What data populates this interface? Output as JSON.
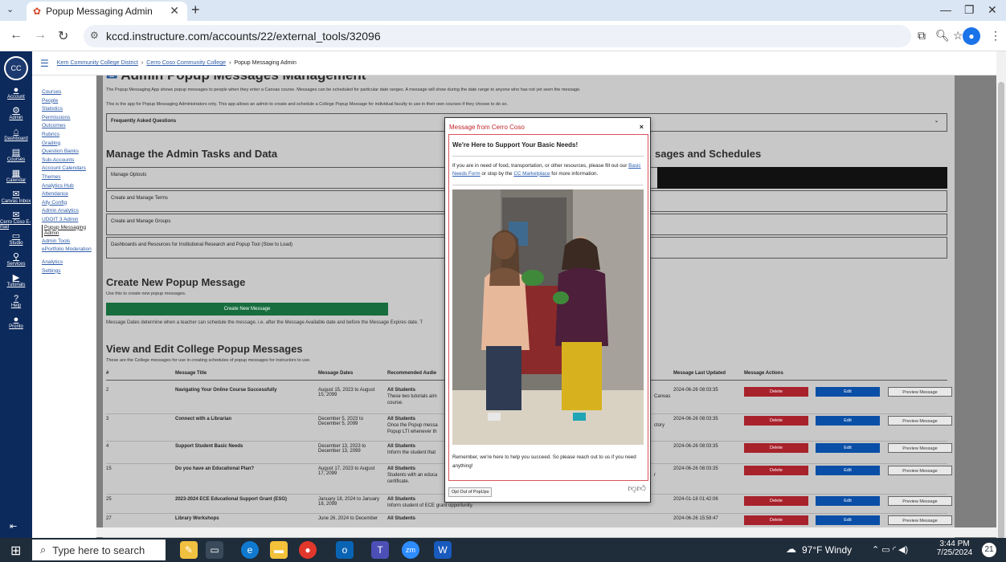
{
  "browser": {
    "tab_title": "Popup Messaging Admin",
    "url": "kccd.instructure.com/accounts/22/external_tools/32096"
  },
  "global_nav": [
    "Account",
    "Admin",
    "Dashboard",
    "Courses",
    "Calendar",
    "Canvas Inbox",
    "Cerro Coso E-mail",
    "Studio",
    "Services",
    "Tutorials",
    "Help",
    "Pronto"
  ],
  "breadcrumb": [
    "Kern Community College District",
    "Cerro Coso Community College",
    "Popup Messaging Admin"
  ],
  "sub_nav": [
    "Courses",
    "People",
    "Statistics",
    "Permissions",
    "Outcomes",
    "Rubrics",
    "Grading",
    "Question Banks",
    "Sub-Accounts",
    "Account Calendars",
    "Themes",
    "Analytics Hub",
    "Attendance",
    "Ally Config",
    "Admin Analytics",
    "UDOIT 3 Admin",
    "Popup Messaging Admin",
    "Admin Tools",
    "ePortfolio Moderation",
    "Analytics",
    "Settings"
  ],
  "page": {
    "title": "Admin Popup Messages Management",
    "intro1": "The Popup Messaging App shows popup messages to people when they enter a Canvas course. Messages can be scheduled for particular date ranges. A message will show during the date range to anyone who has not yet seen the message.",
    "intro2": "This is the app for Popup Messaging Administrators only. This app allows an admin to create and schedule a College Popup Message for individual faculty to use in their own courses if they choose to do so.",
    "faq": "Frequently Asked Questions",
    "manage_heading": "Manage the Admin Tasks and Data",
    "manage_right_heading": "sages and Schedules",
    "optouts": "Manage Optouts",
    "terms": "Create and Manage Terms",
    "groups": "Create and Manage Groups",
    "dashboards": "Dashboards and Resources for Institutional Research and Popup Tool (Slow to Load)",
    "create_heading": "Create New Popup Message",
    "create_sub": "Use this to create new popup messages.",
    "create_btn": "Create New Message",
    "dates_note": "Message Dates determine when a teacher can schedule the message. i.e. after the Message Available date and before the Message Expires date. T",
    "view_heading": "View and Edit College Popup Messages",
    "view_sub": "These are the College messages for use in creating schedules of popup messages for instructors to use."
  },
  "table": {
    "headers": [
      "#",
      "Message Title",
      "Message Dates",
      "Recommended Audie",
      "Message Last Updated",
      "Message Actions"
    ],
    "rows": [
      {
        "id": "2",
        "title": "Navigating Your Online Course Successfully",
        "dates": "August 15, 2023 to August 15, 2099",
        "aud": "All Students",
        "desc": "These two tutorials aim",
        "desc2": "course.",
        "tail": "Canvas",
        "updated": "2024-06-26 08:03:35"
      },
      {
        "id": "3",
        "title": "Connect with a Librarian",
        "dates": "December 5, 2023 to December 5, 2099",
        "aud": "All Students",
        "desc": "Once the Popup messa",
        "desc2": "Popup LTI whenever th",
        "tail": "ctory",
        "updated": "2024-06-26 08:03:35"
      },
      {
        "id": "4",
        "title": "Support Student Basic Needs",
        "dates": "December 13, 2023 to December 13, 2099",
        "aud": "All Students",
        "desc": "Inform the student that",
        "desc2": "",
        "tail": "",
        "updated": "2024-06-26 08:03:35"
      },
      {
        "id": "15",
        "title": "Do you have an Educational Plan?",
        "dates": "August 17, 2023 to August 17, 2099",
        "aud": "All Students",
        "desc": "Students with an educa",
        "desc2": "certificate.",
        "tail": "r",
        "updated": "2024-06-26 08:03:35"
      },
      {
        "id": "25",
        "title": "2023-2024 ECE Educational Support Grant (ESG)",
        "dates": "January 18, 2024 to January 18, 2099",
        "aud": "All Students",
        "desc": "Inform student of ECE grant opportunity.",
        "desc2": "",
        "tail": "",
        "updated": "2024-01-18 01:42:06"
      },
      {
        "id": "27",
        "title": "Library Workshops",
        "dates": "June 26, 2024 to December",
        "aud": "All Students",
        "desc": "",
        "desc2": "",
        "tail": "",
        "updated": "2024-06-26 15:59:47"
      }
    ],
    "delete": "Delete",
    "edit": "Edit",
    "preview": "Preview Message"
  },
  "modal": {
    "header": "Message from Cerro Coso",
    "title": "We're Here to Support Your Basic Needs!",
    "body_pre": "If you are in need of food, transportation, or other resources, please fill out our ",
    "link1": "Basic Needs Form",
    "body_mid": " or stop by the ",
    "link2": "CC Marketplace",
    "body_post": " for more information.",
    "footer": "Remember, we're here to help you succeed. So please reach out to us if you need anything!",
    "optout": "Opt Out of PopUps"
  },
  "taskbar": {
    "search": "Type here to search",
    "weather": "97°F Windy",
    "time": "3:44 PM",
    "date": "7/25/2024",
    "notif": "21"
  }
}
